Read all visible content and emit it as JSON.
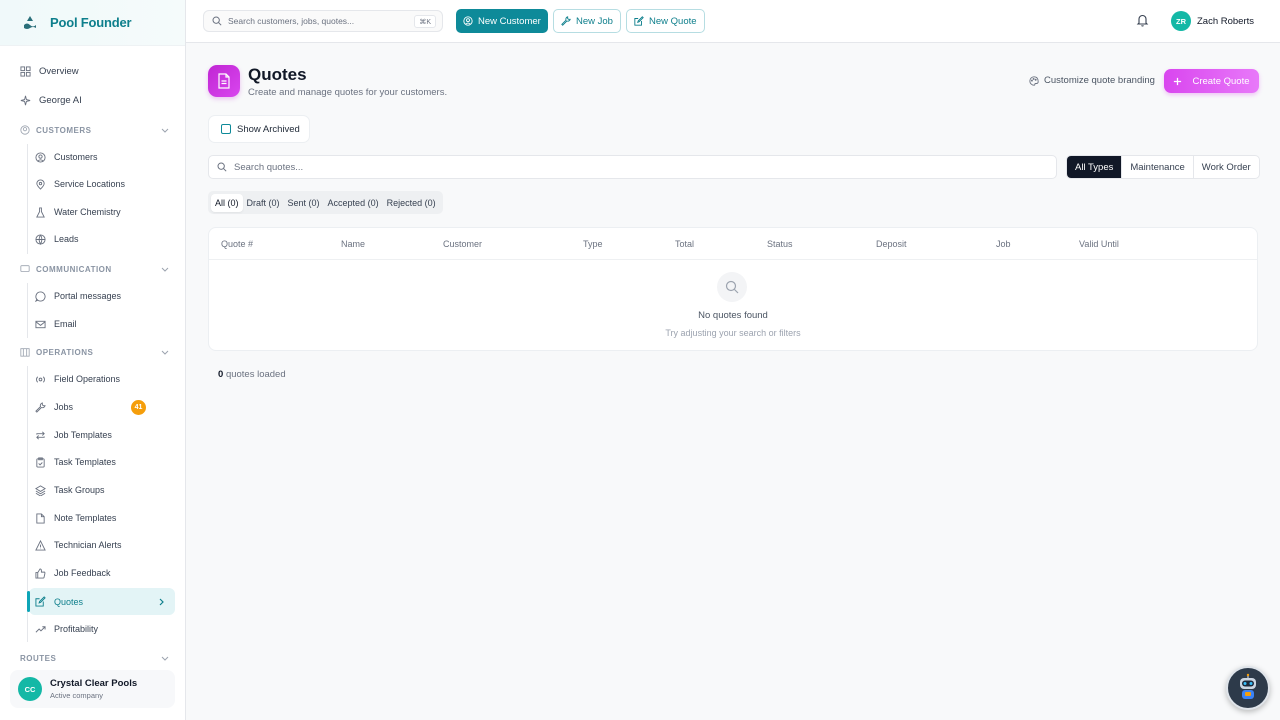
{
  "brand": {
    "name": "Pool Founder"
  },
  "sidebar": {
    "top_items": [
      {
        "label": "Overview",
        "icon": "grid-icon"
      },
      {
        "label": "George AI",
        "icon": "sparkle-icon"
      }
    ],
    "sections": [
      {
        "title": "CUSTOMERS",
        "items": [
          {
            "label": "Customers"
          },
          {
            "label": "Service Locations"
          },
          {
            "label": "Water Chemistry"
          },
          {
            "label": "Leads"
          }
        ]
      },
      {
        "title": "COMMUNICATION",
        "items": [
          {
            "label": "Portal messages"
          },
          {
            "label": "Email"
          }
        ]
      },
      {
        "title": "OPERATIONS",
        "items": [
          {
            "label": "Field Operations"
          },
          {
            "label": "Jobs",
            "badge": "41"
          },
          {
            "label": "Job Templates"
          },
          {
            "label": "Task Templates"
          },
          {
            "label": "Task Groups"
          },
          {
            "label": "Note Templates"
          },
          {
            "label": "Technician Alerts"
          },
          {
            "label": "Job Feedback"
          },
          {
            "label": "Quotes",
            "active": true
          },
          {
            "label": "Profitability"
          }
        ]
      },
      {
        "title": "ROUTES",
        "items": []
      }
    ],
    "company": {
      "initials": "CC",
      "name": "Crystal Clear Pools",
      "subtitle": "Active company"
    }
  },
  "topbar": {
    "search_placeholder": "Search customers, jobs, quotes...",
    "search_shortcut": "⌘K",
    "new_customer": "New Customer",
    "new_job": "New Job",
    "new_quote": "New Quote",
    "user": {
      "initials": "ZR",
      "name": "Zach Roberts"
    }
  },
  "page": {
    "title": "Quotes",
    "subtitle": "Create and manage quotes for your customers.",
    "branding_link": "Customize quote branding",
    "create_button": "Create Quote",
    "show_archived": "Show Archived",
    "search_placeholder": "Search quotes...",
    "type_filters": [
      "All Types",
      "Maintenance",
      "Work Order"
    ],
    "selected_type": "All Types",
    "status_tabs": [
      "All (0)",
      "Draft (0)",
      "Sent (0)",
      "Accepted (0)",
      "Rejected (0)"
    ],
    "selected_status": "All (0)",
    "table": {
      "columns": [
        "Quote #",
        "Name",
        "Customer",
        "Type",
        "Total",
        "Status",
        "Deposit",
        "Job",
        "Valid Until"
      ],
      "rows": [],
      "empty_title": "No quotes found",
      "empty_subtitle": "Try adjusting your search or filters"
    },
    "loaded_count": "0",
    "loaded_suffix": "quotes loaded"
  },
  "colors": {
    "brand": "#0e8a99",
    "accent": "#d946ef",
    "badge": "#f59e0b"
  }
}
